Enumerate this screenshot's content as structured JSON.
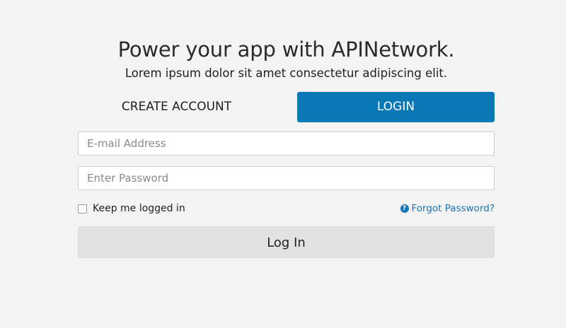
{
  "header": {
    "title": "Power your app with APINetwork.",
    "subtitle": "Lorem ipsum dolor sit amet consectetur adipiscing elit."
  },
  "tabs": {
    "create_account": "CREATE ACCOUNT",
    "login": "LOGIN",
    "active": "login"
  },
  "form": {
    "email": {
      "placeholder": "E-mail Address",
      "value": ""
    },
    "password": {
      "placeholder": "Enter Password",
      "value": ""
    },
    "remember": {
      "label": "Keep me logged in",
      "checked": false
    },
    "forgot": {
      "label": "Forgot Password?",
      "icon": "question-circle-icon"
    },
    "submit_label": "Log In"
  },
  "colors": {
    "background": "#f3f3f3",
    "accent": "#0a78b5",
    "link": "#1a73b5",
    "submit_bg": "#e2e2e2"
  }
}
